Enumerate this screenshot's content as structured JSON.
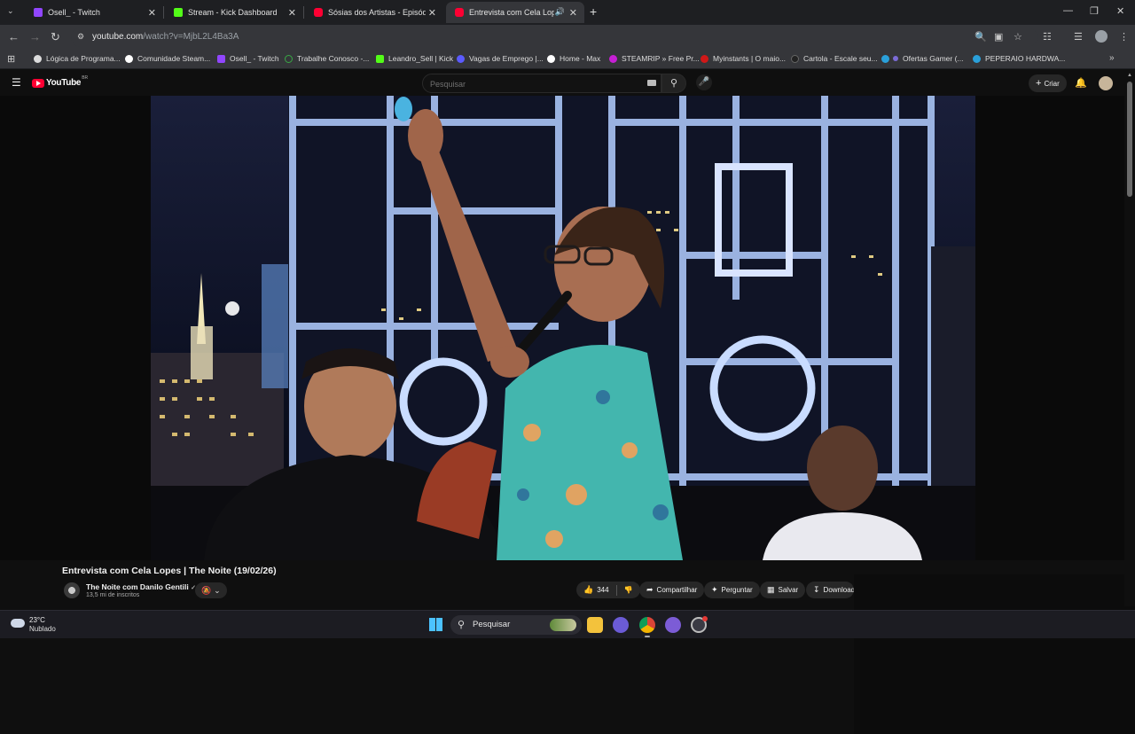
{
  "browser": {
    "tabs": [
      {
        "title": "Osell_ - Twitch",
        "favicon_color": "#9146ff",
        "active": false
      },
      {
        "title": "Stream - Kick Dashboard",
        "favicon_color": "#53fc18",
        "active": false
      },
      {
        "title": "Sósias dos Artistas - Episódio 1",
        "favicon_color": "#ff0033",
        "active": false
      },
      {
        "title": "Entrevista com Cela Lopes",
        "favicon_color": "#ff0033",
        "active": true
      }
    ],
    "new_tab_label": "+",
    "url_host": "youtube.com",
    "url_path": "/watch?v=MjbL2L4Ba3A",
    "bookmarks": [
      {
        "label": "Lógica de Programa...",
        "color": "#dcdcdc"
      },
      {
        "label": "Comunidade Steam...",
        "color": "#ffffff"
      },
      {
        "label": "Osell_ - Twitch",
        "color": "#9146ff"
      },
      {
        "label": "Trabalhe Conosco -...",
        "color": "#39a845"
      },
      {
        "label": "Leandro_Sell | Kick",
        "color": "#53fc18"
      },
      {
        "label": "Vagas de Emprego |...",
        "color": "#5b5bff"
      },
      {
        "label": "Home - Max",
        "color": "#ffffff"
      },
      {
        "label": "STEAMRIP » Free Pr...",
        "color": "#c61fd4"
      },
      {
        "label": "Myinstants | O maio...",
        "color": "#d01818"
      },
      {
        "label": "Cartola - Escale seu...",
        "color": "#222222"
      },
      {
        "label": "Ofertas Gamer (...",
        "color": "#2aa0da"
      },
      {
        "label": "PEPERAIO HARDWA...",
        "color": "#2aa0da"
      }
    ]
  },
  "youtube": {
    "logo_text": "YouTube",
    "country_code": "BR",
    "search_placeholder": "Pesquisar",
    "create_label": "Criar",
    "video_title": "Entrevista com Cela Lopes | The Noite (19/02/26)",
    "channel_name": "The Noite com Danilo Gentili",
    "subscribers": "13,5 mi de inscritos",
    "likes": "344",
    "share_label": "Compartilhar",
    "ask_label": "Perguntar",
    "save_label": "Salvar",
    "download_label": "Download"
  },
  "taskbar": {
    "temperature": "23°C",
    "weather": "Nublado",
    "search_label": "Pesquisar"
  }
}
